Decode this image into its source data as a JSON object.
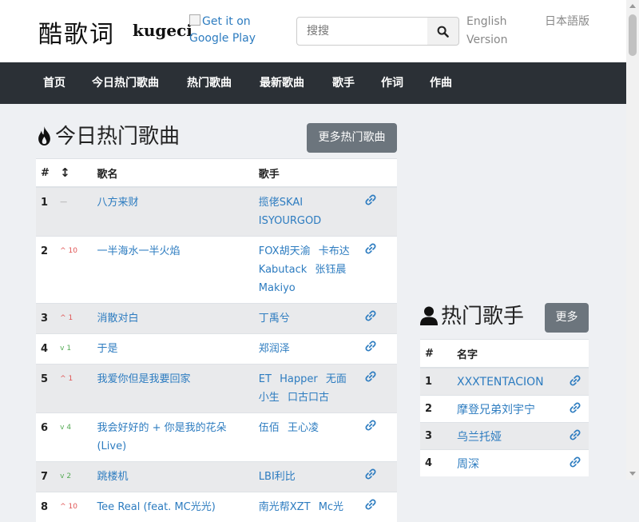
{
  "header": {
    "logo_cn": "酷歌词",
    "logo_en": "kugeci",
    "google_play_alt": "Get it on Google Play",
    "search_placeholder": "搜搜",
    "lang_en": "English Version",
    "lang_jp": "日本語版"
  },
  "nav": [
    "首页",
    "今日热门歌曲",
    "热门歌曲",
    "最新歌曲",
    "歌手",
    "作词",
    "作曲"
  ],
  "hot_songs": {
    "title": "今日热门歌曲",
    "more_label": "更多热门歌曲",
    "col_num": "#",
    "col_trend": "↕",
    "col_title": "歌名",
    "col_artist": "歌手",
    "rows": [
      {
        "num": "1",
        "trend": "—",
        "trend_dir": "same",
        "title": "八方来财",
        "artists": [
          "揽佬SKAI ISYOURGOD"
        ]
      },
      {
        "num": "2",
        "trend": "^ 10",
        "trend_dir": "up",
        "title": "一半海水一半火焰",
        "artists": [
          "FOX胡天渝",
          "卡布达Kabutack",
          "张钰晨Makiyo"
        ]
      },
      {
        "num": "3",
        "trend": "^ 1",
        "trend_dir": "up",
        "title": "消散对白",
        "artists": [
          "丁禹兮"
        ]
      },
      {
        "num": "4",
        "trend": "v 1",
        "trend_dir": "down",
        "title": "于是",
        "artists": [
          "郑润泽"
        ]
      },
      {
        "num": "5",
        "trend": "^ 1",
        "trend_dir": "up",
        "title": "我爱你但是我要回家",
        "artists": [
          "ET",
          "Happer",
          "无面小生",
          "口古口古"
        ]
      },
      {
        "num": "6",
        "trend": "v 4",
        "trend_dir": "down",
        "title": "我会好好的 + 你是我的花朵 (Live)",
        "artists": [
          "伍佰",
          "王心凌"
        ]
      },
      {
        "num": "7",
        "trend": "v 2",
        "trend_dir": "down",
        "title": "跳楼机",
        "artists": [
          "LBI利比"
        ]
      },
      {
        "num": "8",
        "trend": "^ 10",
        "trend_dir": "up",
        "title": "Tee Real (feat. MC光光)",
        "artists": [
          "南光帮XZT",
          "Mc光"
        ]
      }
    ]
  },
  "hot_artists": {
    "title": "热门歌手",
    "more_label": "更多",
    "col_num": "#",
    "col_name": "名字",
    "rows": [
      {
        "num": "1",
        "name": "XXXTENTACION"
      },
      {
        "num": "2",
        "name": "摩登兄弟刘宇宁"
      },
      {
        "num": "3",
        "name": "乌兰托娅"
      },
      {
        "num": "4",
        "name": "周深"
      }
    ]
  },
  "colors": {
    "nav_bg": "#2b3036",
    "link": "#2d7cc0",
    "button_gray": "#6c757d",
    "trend_up": "#e05656",
    "trend_down": "#55aa55"
  }
}
